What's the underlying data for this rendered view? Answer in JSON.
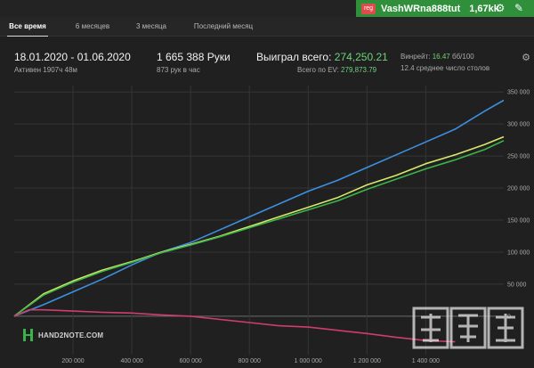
{
  "user": {
    "badge": "reg",
    "name": "VashWRna888tut",
    "hands": "1,67kk"
  },
  "tabs": [
    {
      "label": "Все время",
      "active": true
    },
    {
      "label": "6 месяцев",
      "active": false
    },
    {
      "label": "3 месяца",
      "active": false
    },
    {
      "label": "Последний месяц",
      "active": false
    }
  ],
  "stats": {
    "date_range": "18.01.2020 - 01.06.2020",
    "active_time": "Активен 1907ч 48м",
    "hands_total": "1 665 388 Руки",
    "hands_per_hour": "873 рук в час",
    "won_label": "Выиграл всего:",
    "won_value": "274,250.21",
    "ev_label": "Всего по EV:",
    "ev_value": "279,873.79",
    "winrate_label": "Винрейт:",
    "winrate_value": "16.47",
    "winrate_unit": "бб/100",
    "avg_tables": "12.4 среднее число столов"
  },
  "logo_text": "HAND2NOTE.COM",
  "colors": {
    "accent_green": "#2f8f3b",
    "blue_line": "#3d8fe0",
    "yellow_line": "#d8e86a",
    "green_line": "#3cb54a",
    "red_line": "#d03c6e"
  },
  "chart_data": {
    "type": "line",
    "x_ticks": [
      "200 000",
      "400 000",
      "600 000",
      "800 000",
      "1 000 000",
      "1 200 000",
      "1 400 000"
    ],
    "y_ticks": [
      "0",
      "50 000",
      "100 000",
      "150 000",
      "200 000",
      "250 000",
      "300 000",
      "350 000"
    ],
    "xlim": [
      0,
      1665388
    ],
    "ylim": [
      -60000,
      360000
    ],
    "grid": true,
    "series": [
      {
        "color": "blue",
        "x": [
          0,
          100000,
          200000,
          300000,
          400000,
          500000,
          600000,
          700000,
          800000,
          900000,
          1000000,
          1100000,
          1200000,
          1300000,
          1400000,
          1500000,
          1600000,
          1665388
        ],
        "y": [
          0,
          18000,
          38000,
          58000,
          80000,
          100000,
          115000,
          135000,
          155000,
          175000,
          195000,
          212000,
          232000,
          252000,
          272000,
          292000,
          320000,
          337000
        ]
      },
      {
        "color": "yellow",
        "x": [
          0,
          100000,
          200000,
          300000,
          400000,
          500000,
          600000,
          700000,
          800000,
          900000,
          1000000,
          1100000,
          1200000,
          1300000,
          1400000,
          1500000,
          1600000,
          1665388
        ],
        "y": [
          0,
          35000,
          55000,
          72000,
          85000,
          100000,
          112000,
          125000,
          140000,
          155000,
          170000,
          185000,
          205000,
          220000,
          238000,
          252000,
          268000,
          280000
        ]
      },
      {
        "color": "green",
        "x": [
          0,
          100000,
          200000,
          300000,
          400000,
          500000,
          600000,
          700000,
          800000,
          900000,
          1000000,
          1100000,
          1200000,
          1300000,
          1400000,
          1500000,
          1600000,
          1665388
        ],
        "y": [
          0,
          33000,
          53000,
          70000,
          84000,
          99000,
          111000,
          124000,
          138000,
          152000,
          166000,
          180000,
          198000,
          214000,
          230000,
          244000,
          260000,
          274000
        ]
      },
      {
        "color": "red",
        "x": [
          0,
          50000,
          100000,
          200000,
          300000,
          400000,
          500000,
          600000,
          700000,
          800000,
          900000,
          1000000,
          1100000,
          1200000,
          1300000,
          1400000,
          1500000
        ],
        "y": [
          0,
          10000,
          10000,
          8000,
          6000,
          5000,
          2000,
          0,
          -5000,
          -10000,
          -15000,
          -17000,
          -22000,
          -27000,
          -33000,
          -38000,
          -40000
        ]
      }
    ]
  }
}
